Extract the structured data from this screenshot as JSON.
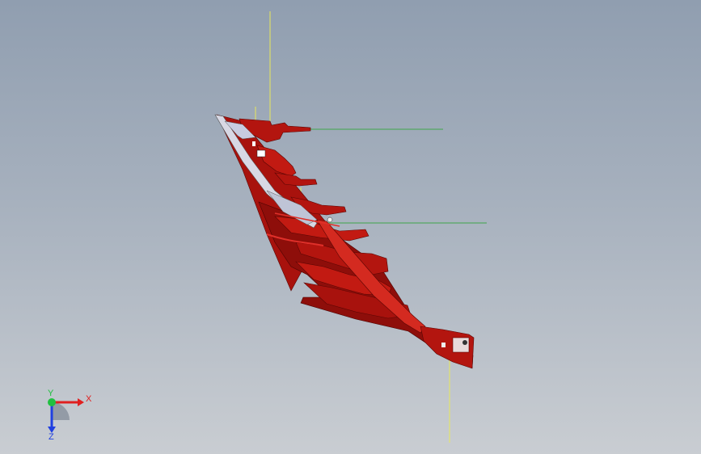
{
  "viewport": {
    "background_top": "#909eb0",
    "background_bottom": "#c9cdd2",
    "model_color": "#b0140f",
    "model_shade": "#7a0a07",
    "model_highlight": "#e0302a",
    "reference_line_yellow": "#e8e85a",
    "reference_line_green": "#3fa64a"
  },
  "triad": {
    "x_label": "X",
    "y_label": "Y",
    "z_label": "Z",
    "x_color": "#e02020",
    "y_color": "#20c040",
    "z_color": "#2040e0"
  }
}
